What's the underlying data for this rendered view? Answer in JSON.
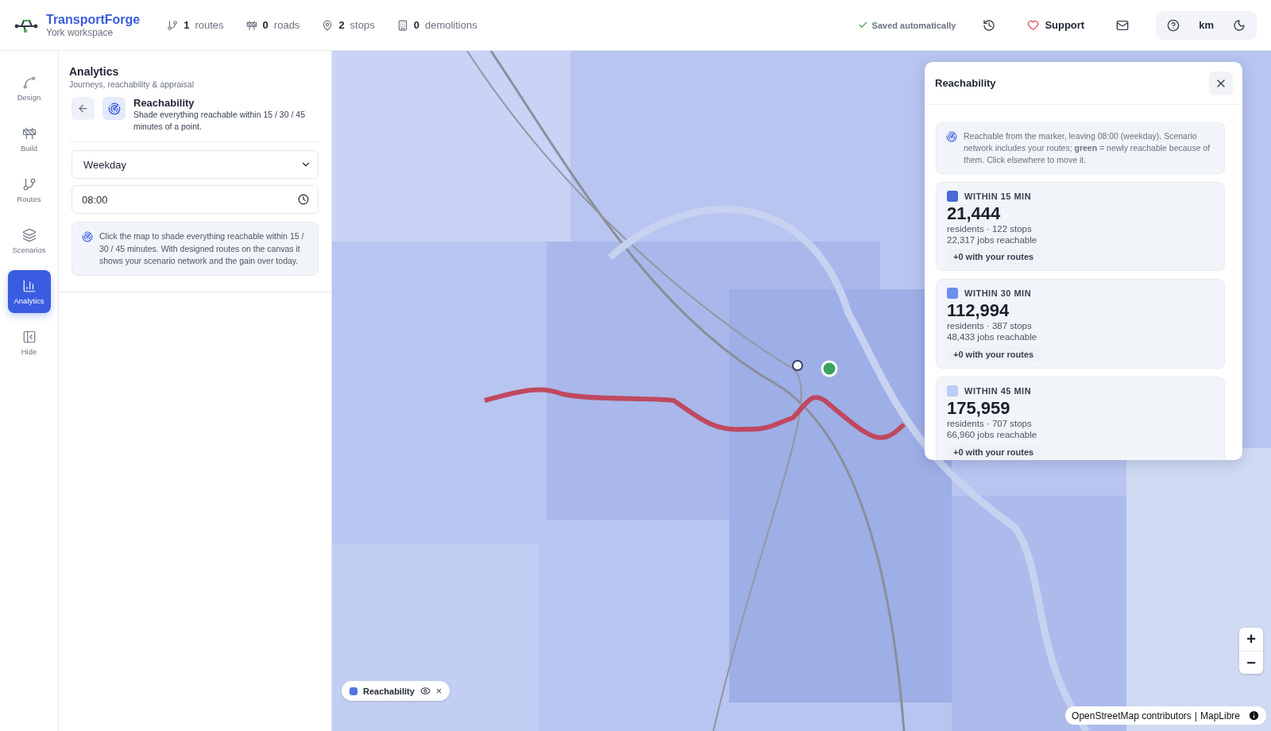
{
  "app": {
    "name": "TransportForge",
    "workspace": "York workspace"
  },
  "counters": [
    {
      "kind": "routes",
      "value": "1",
      "label": "routes"
    },
    {
      "kind": "roads",
      "value": "0",
      "label": "roads"
    },
    {
      "kind": "stops",
      "value": "2",
      "label": "stops"
    },
    {
      "kind": "demolitions",
      "value": "0",
      "label": "demolitions"
    }
  ],
  "save_status": "Saved automatically",
  "support": "Support",
  "units": "km",
  "nav": [
    {
      "kind": "design",
      "label": "Design",
      "selected": false
    },
    {
      "kind": "build",
      "label": "Build",
      "selected": false
    },
    {
      "kind": "routes",
      "label": "Routes",
      "selected": false
    },
    {
      "kind": "scenarios",
      "label": "Scenarios",
      "selected": false
    },
    {
      "kind": "analytics",
      "label": "Analytics",
      "selected": true
    },
    {
      "kind": "hide",
      "label": "Hide",
      "selected": false
    }
  ],
  "panel": {
    "title": "Analytics",
    "subtitle": "Journeys, reachability & appraisal",
    "tool": {
      "title": "Reachability",
      "description": "Shade everything reachable within 15 / 30 / 45 minutes of a point."
    },
    "day_select": {
      "value": "Weekday"
    },
    "time_field": {
      "value": "08:00"
    },
    "hint": "Click the map to shade everything reachable within 15 / 30 / 45 minutes. With designed routes on the canvas it shows your scenario network and the gain over today."
  },
  "map": {
    "kind": "picture",
    "legend": {
      "label": "Reachability",
      "color": "#4f74e3",
      "close": "×"
    },
    "zoom_in": "+",
    "zoom_out": "−",
    "attribution": [
      "OpenStreetMap contributors",
      "MapLibre"
    ],
    "attribution_separator": "|"
  },
  "reach_panel": {
    "title": "Reachability",
    "note": "Reachable from the marker, leaving 08:00 (weekday). Scenario network includes your routes; **green** = newly reachable because of them. Click elsewhere to move it.",
    "bands": [
      {
        "label": "WITHIN 15 MIN",
        "color": "#4a68d6",
        "residents": "21,444",
        "stats": "residents · 122 stops",
        "jobs": "22,317 jobs reachable",
        "gain": "+0 with your routes"
      },
      {
        "label": "WITHIN 30 MIN",
        "color": "#6b8ff0",
        "residents": "112,994",
        "stats": "residents · 387 stops",
        "jobs": "48,433 jobs reachable",
        "gain": "+0 with your routes"
      },
      {
        "label": "WITHIN 45 MIN",
        "color": "#b9cdf8",
        "residents": "175,959",
        "stats": "residents · 707 stops",
        "jobs": "66,960 jobs reachable",
        "gain": "+0 with your routes"
      }
    ]
  }
}
